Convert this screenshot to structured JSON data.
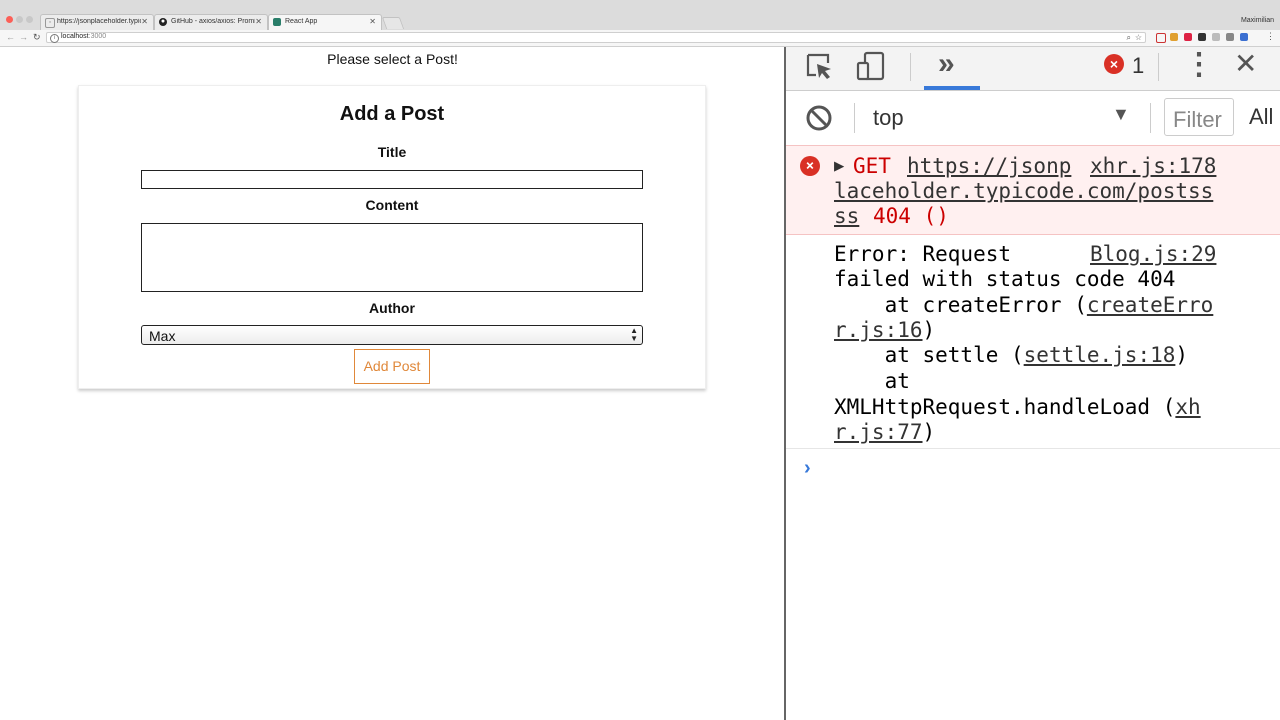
{
  "browser": {
    "tabs": [
      {
        "title": "https://jsonplaceholder.typico",
        "active": false
      },
      {
        "title": "GitHub - axios/axios: Promise",
        "active": false
      },
      {
        "title": "React App",
        "active": true
      }
    ],
    "profile": "Maximilian",
    "url_host": "localhost",
    "url_port": ":3000"
  },
  "page": {
    "select_message": "Please select a Post!",
    "form": {
      "heading": "Add a Post",
      "title_label": "Title",
      "title_value": "",
      "content_label": "Content",
      "content_value": "",
      "author_label": "Author",
      "author_selected": "Max",
      "submit_label": "Add Post"
    }
  },
  "devtools": {
    "error_count": "1",
    "context": "top",
    "filter_placeholder": "Filter",
    "levels_label": "All",
    "error_entry": {
      "method": "GET",
      "url_part1": "https://jsonp",
      "source": "xhr.js:178",
      "url_part2": "laceholder.typicode.com/postss",
      "url_part3": "ss",
      "status": "404 ()"
    },
    "log_entry": {
      "source": "Blog.js:29",
      "line1": "Error: Request",
      "line2": "failed with status code 404",
      "line3_prefix": "    at createError (",
      "line3_link": "createErro",
      "line4_link": "r.js:16",
      "line4_suffix": ")",
      "line5_prefix": "    at settle (",
      "line5_link": "settle.js:18",
      "line5_suffix": ")",
      "line6": "    at",
      "line7_prefix": "XMLHttpRequest.handleLoad (",
      "line7_link": "xh",
      "line8_link": "r.js:77",
      "line8_suffix": ")"
    },
    "prompt_symbol": "›"
  },
  "colors": {
    "accent": "#e0883a",
    "devtools_blue": "#3879d9",
    "error_red": "#cc0000",
    "error_bg": "#fff0f0"
  }
}
